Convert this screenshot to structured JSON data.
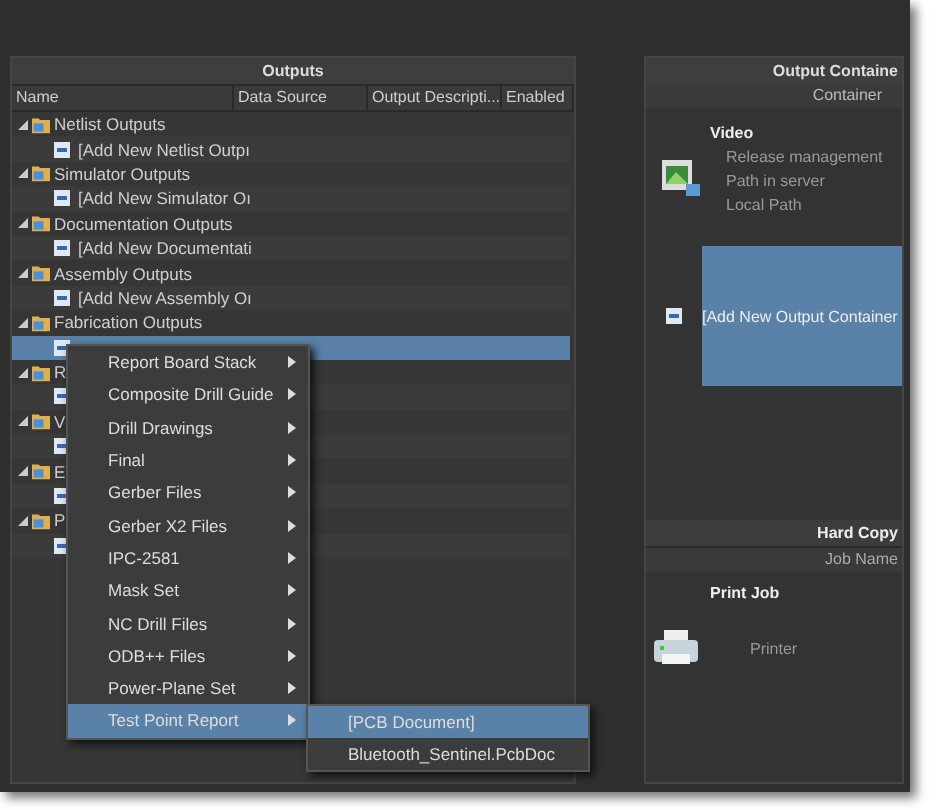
{
  "outputs_panel": {
    "title": "Outputs",
    "columns": [
      "Name",
      "Data Source",
      "Output Descripti...",
      "Enabled"
    ],
    "groups": [
      {
        "label": "Netlist Outputs",
        "expanded": true,
        "children": [
          {
            "label": "[Add New Netlist Outpı",
            "selected": false
          }
        ]
      },
      {
        "label": "Simulator Outputs",
        "expanded": true,
        "children": [
          {
            "label": "[Add New Simulator Oı",
            "selected": false
          }
        ]
      },
      {
        "label": "Documentation Outputs",
        "expanded": true,
        "children": [
          {
            "label": "[Add New Documentati",
            "selected": false
          }
        ]
      },
      {
        "label": "Assembly Outputs",
        "expanded": true,
        "children": [
          {
            "label": "[Add New Assembly Oı",
            "selected": false
          }
        ]
      },
      {
        "label": "Fabrication Outputs",
        "expanded": true,
        "children": [
          {
            "selected": true
          }
        ]
      },
      {
        "label": "R",
        "expanded": true,
        "children": [
          {
            "selected": false
          }
        ]
      },
      {
        "label": "V",
        "expanded": true,
        "children": [
          {
            "selected": false
          }
        ]
      },
      {
        "label": "E",
        "expanded": true,
        "children": [
          {
            "selected": false
          }
        ]
      },
      {
        "label": "P",
        "expanded": true,
        "children": [
          {
            "selected": false
          }
        ]
      }
    ]
  },
  "context_menu": {
    "items": [
      {
        "label": "Report Board Stack",
        "selected": false
      },
      {
        "label": "Composite Drill Guide",
        "selected": false
      },
      {
        "label": "Drill Drawings",
        "selected": false
      },
      {
        "label": "Final",
        "selected": false
      },
      {
        "label": "Gerber Files",
        "selected": false
      },
      {
        "label": "Gerber X2 Files",
        "selected": false
      },
      {
        "label": "IPC-2581",
        "selected": false
      },
      {
        "label": "Mask Set",
        "selected": false
      },
      {
        "label": "NC Drill Files",
        "selected": false
      },
      {
        "label": "ODB++ Files",
        "selected": false
      },
      {
        "label": "Power-Plane Set",
        "selected": false
      },
      {
        "label": "Test Point Report",
        "selected": true
      }
    ],
    "submenu": [
      {
        "label": "[PCB Document]",
        "selected": true
      },
      {
        "label": "Bluetooth_Sentinel.PcbDoc",
        "selected": false
      }
    ]
  },
  "containers_panel": {
    "title": "Output Containe",
    "column": "Container",
    "video": {
      "name": "Video",
      "fields": [
        "Release management",
        "Path in server",
        "Local Path"
      ]
    },
    "add_new": {
      "label": "[Add New Output Container",
      "selected": true
    },
    "hard_copy": {
      "title": "Hard Copy",
      "column": "Job Name",
      "job": "Print Job",
      "printer": "Printer"
    }
  }
}
